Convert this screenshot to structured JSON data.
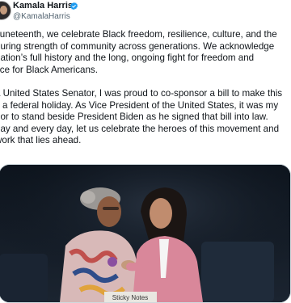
{
  "author": {
    "name": "Kamala Harris",
    "handle": "@KamalaHarris",
    "verified_color": "#1d9bf0"
  },
  "tweet": {
    "lines_p1": [
      "Juneteenth, we celebrate Black freedom, resilience, culture, and the",
      "during strength of community across generations. We acknowledge",
      "nation’s full history and the long, ongoing fight for freedom and",
      "tice for Black Americans."
    ],
    "lines_p2": [
      "a United States Senator, I was proud to co-sponsor a bill to make this",
      "y a federal holiday. As Vice President of the United States, it was my",
      "nor to stand beside President Biden as he signed that bill into law.",
      "day and every day, let us celebrate the heroes of this movement and",
      " work that lies ahead."
    ]
  },
  "media": {
    "sign_text": "Sticky Notes",
    "icons": [
      "verified-badge-icon"
    ]
  }
}
